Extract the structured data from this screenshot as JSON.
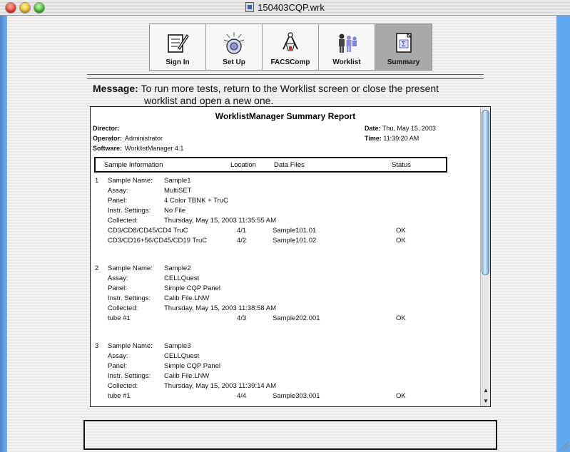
{
  "window": {
    "title": "150403CQP.wrk"
  },
  "toolbar": {
    "buttons": [
      {
        "label": "Sign In",
        "icon": "sign-in-icon",
        "active": false
      },
      {
        "label": "Set Up",
        "icon": "setup-icon",
        "active": false
      },
      {
        "label": "FACSComp",
        "icon": "facscomp-icon",
        "active": false
      },
      {
        "label": "Worklist",
        "icon": "worklist-icon",
        "active": false
      },
      {
        "label": "Summary",
        "icon": "summary-icon",
        "active": true
      }
    ]
  },
  "message": {
    "key": "Message:",
    "line1": "To run more tests, return to the Worklist screen or close the present",
    "line2": "worklist and open a new one."
  },
  "report": {
    "title": "WorklistManager Summary Report",
    "director_label": "Director:",
    "director_value": "",
    "operator_label": "Operator:",
    "operator_value": "Administrator",
    "software_label": "Software:",
    "software_value": "WorklistManager  4.1",
    "date_label": "Date:",
    "date_value": "Thu, May 15, 2003",
    "time_label": "Time:",
    "time_value": "11:39:20 AM",
    "columns": {
      "sample_info": "Sample Information",
      "location": "Location",
      "data_files": "Data Files",
      "status": "Status"
    },
    "samples": [
      {
        "index": "1",
        "name_label": "Sample Name:",
        "name": "Sample1",
        "assay_label": "Assay:",
        "assay": "MultiSET",
        "panel_label": "Panel:",
        "panel": "4 Color TBNK + TruC",
        "instr_label": "Instr. Settings:",
        "instr": "No File",
        "collected_label": "Collected:",
        "collected": "Thursday, May 15, 2003  11:35:55 AM",
        "tubes": [
          {
            "name": "CD3/CD8/CD45/CD4 TruC",
            "location": "4/1",
            "file": "Sample101.01",
            "status": "OK"
          },
          {
            "name": "CD3/CD16+56/CD45/CD19 TruC",
            "location": "4/2",
            "file": "Sample101.02",
            "status": "OK"
          }
        ]
      },
      {
        "index": "2",
        "name_label": "Sample Name:",
        "name": "Sample2",
        "assay_label": "Assay:",
        "assay": "CELLQuest",
        "panel_label": "Panel:",
        "panel": "Simple CQP Panel",
        "instr_label": "Instr. Settings:",
        "instr": "Calib File.LNW",
        "collected_label": "Collected:",
        "collected": "Thursday, May 15, 2003  11:38:58 AM",
        "tubes": [
          {
            "name": "tube #1",
            "location": "4/3",
            "file": "Sample202.001",
            "status": "OK"
          }
        ]
      },
      {
        "index": "3",
        "name_label": "Sample Name:",
        "name": "Sample3",
        "assay_label": "Assay:",
        "assay": "CELLQuest",
        "panel_label": "Panel:",
        "panel": "Simple CQP Panel",
        "instr_label": "Instr. Settings:",
        "instr": "Calib File.LNW",
        "collected_label": "Collected:",
        "collected": "Thursday, May 15, 2003  11:39:14 AM",
        "tubes": [
          {
            "name": "tube #1",
            "location": "4/4",
            "file": "Sample303.001",
            "status": "OK"
          }
        ]
      }
    ]
  },
  "scrollbar": {
    "up_arrow": "▲",
    "down_arrow": "▼"
  }
}
